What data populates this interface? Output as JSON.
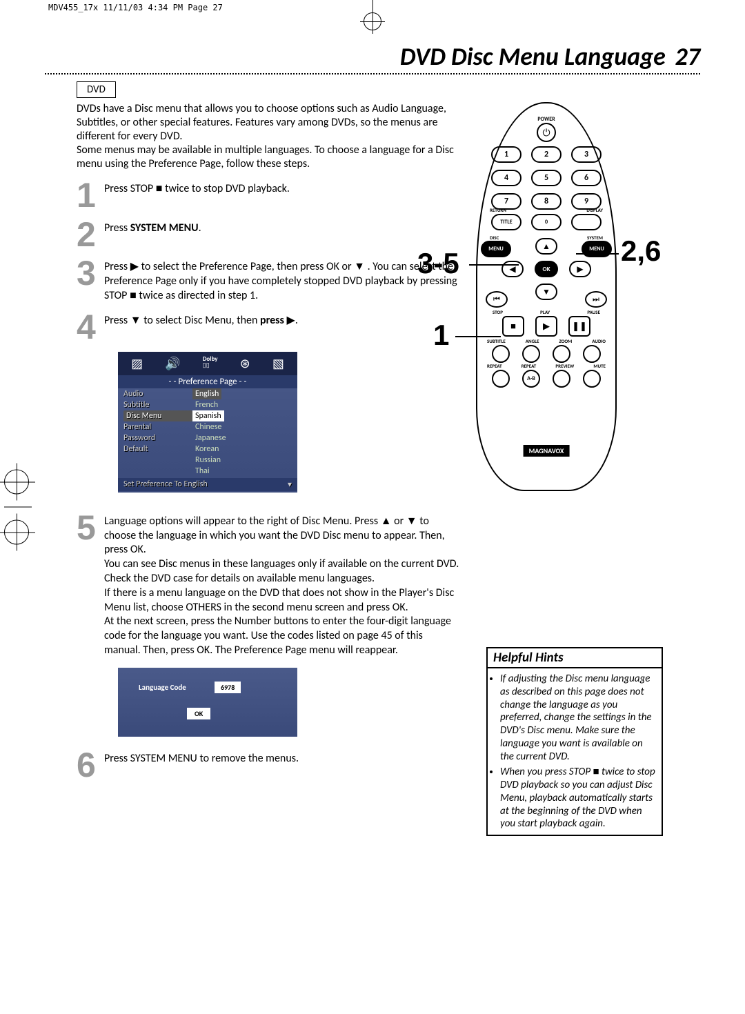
{
  "print_header": "MDV455_17x  11/11/03  4:34 PM  Page 27",
  "title": "DVD Disc Menu Language",
  "page_number": "27",
  "media_label": "DVD",
  "intro": "DVDs have a Disc menu that allows you to choose options such as Audio Language, Subtitles, or other special features. Features vary among DVDs, so the menus are different for every DVD.\nSome menus may be available in multiple languages. To choose a language for a Disc menu using the Preference Page, follow these steps.",
  "steps": {
    "1": {
      "text_a": "Press STOP ",
      "text_b": " twice to stop DVD playback."
    },
    "2": {
      "text_a": "Press ",
      "bold": "SYSTEM MENU",
      "text_b": "."
    },
    "3": {
      "text_a": "Press ",
      "text_b": " to select the Preference Page, then press OK or ",
      "text_c": " . You can select the Preference Page only if you have completely stopped DVD playback by pressing STOP ",
      "text_d": " twice as directed in step 1."
    },
    "4": {
      "text_a": "Press ",
      "text_b": " to select Disc Menu, then ",
      "bold": "press ",
      "text_c": "."
    },
    "5": {
      "p1": "Language options will appear to the right of Disc Menu. Press ▲ or ▼ to choose the language in which you want the DVD Disc menu to appear. Then, press OK.",
      "p2": "You can see Disc menus in these languages only if available on the current DVD. Check the DVD case for details on available menu languages.",
      "p3": "If there is a menu language on the DVD that does not show in the Player's Disc Menu list, choose OTHERS in the second menu screen and press OK.",
      "p4": "At the next screen, press the Number buttons to enter the four-digit language code for the language you want. Use the codes listed on page 45 of this manual. Then, press OK. The Preference Page menu will reappear."
    },
    "6": {
      "text": "Press SYSTEM MENU to remove the menus."
    }
  },
  "pref_screen": {
    "title": "- -    Preference Page    - -",
    "items": [
      "Audio",
      "Subtitle",
      "Disc Menu",
      "Parental",
      "Password",
      "Default"
    ],
    "options": [
      "English",
      "French",
      "Spanish",
      "Chinese",
      "Japanese",
      "Korean",
      "Russian",
      "Thai"
    ],
    "footer": "Set Preference To English"
  },
  "lang_code": {
    "label": "Language Code",
    "value": "6978",
    "ok": "OK"
  },
  "remote": {
    "power": "POWER",
    "numbers": [
      "1",
      "2",
      "3",
      "4",
      "5",
      "6",
      "7",
      "8",
      "9"
    ],
    "zero": "0",
    "return": "RETURN",
    "display": "DISPLAY",
    "title": "TITLE",
    "disc": "DISC",
    "system": "SYSTEM",
    "menu": "MENU",
    "ok": "OK",
    "stop": "STOP",
    "play": "PLAY",
    "pause": "PAUSE",
    "row1": [
      "SUBTITLE",
      "ANGLE",
      "ZOOM",
      "AUDIO"
    ],
    "row2": [
      "REPEAT",
      "REPEAT",
      "PREVIEW",
      "MUTE"
    ],
    "ab": "A-B",
    "brand": "MAGNAVOX"
  },
  "callouts": {
    "c35": "3-5",
    "c26": "2,6",
    "c1": "1"
  },
  "hints": {
    "title": "Helpful Hints",
    "items": [
      "If adjusting the Disc menu language as described on this page does not change the language as you preferred, change the settings in the DVD's Disc menu. Make sure the language you want is available on the current DVD.",
      "When you press STOP ■ twice to stop DVD playback so you can adjust Disc Menu, playback automatically starts at the beginning of the DVD when you start playback again."
    ]
  }
}
